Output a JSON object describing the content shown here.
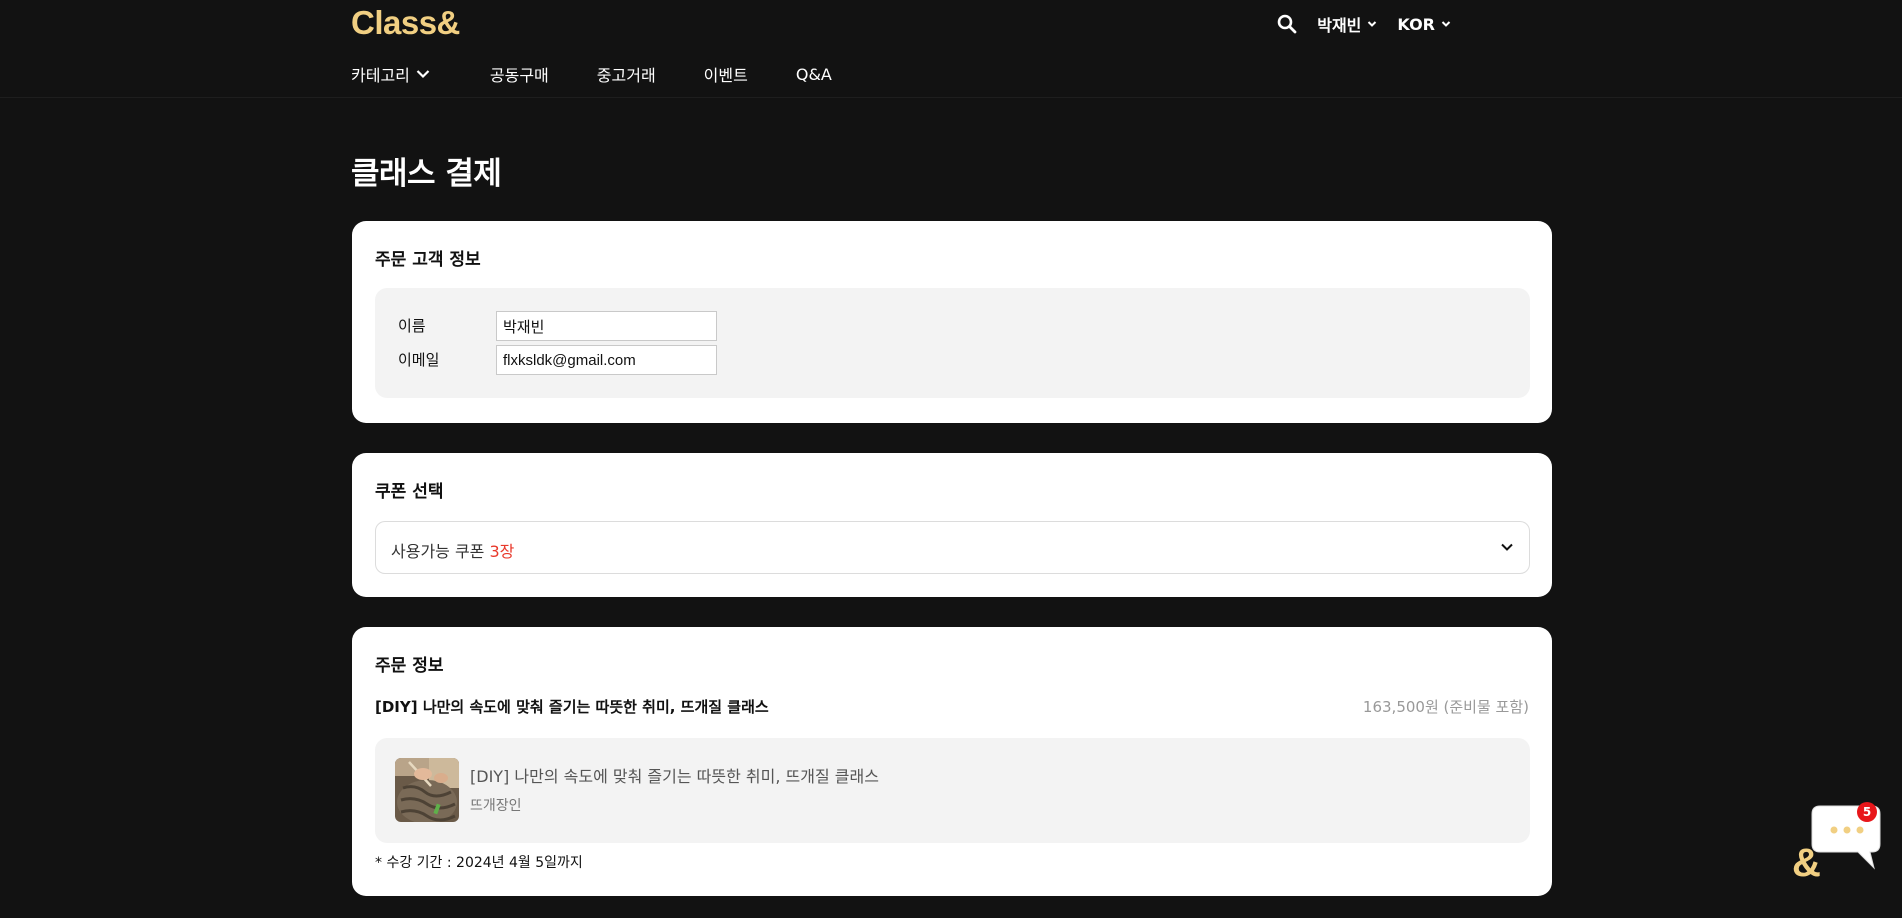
{
  "header": {
    "logo": "Class&",
    "user_menu": "박재빈",
    "language": "KOR"
  },
  "nav": {
    "items": [
      {
        "label": "카테고리"
      },
      {
        "label": "공동구매"
      },
      {
        "label": "중고거래"
      },
      {
        "label": "이벤트"
      },
      {
        "label": "Q&A"
      }
    ]
  },
  "page": {
    "title": "클래스 결제"
  },
  "customer": {
    "title": "주문 고객 정보",
    "name_label": "이름",
    "name_value": "박재빈",
    "email_label": "이메일",
    "email_value": "flxksldk@gmail.com"
  },
  "coupon": {
    "title": "쿠폰 선택",
    "available_label": "사용가능 쿠폰",
    "available_count": "3장"
  },
  "order": {
    "title": "주문 정보",
    "class_name": "[DIY] 나만의 속도에 맞춰 즐기는 따뜻한 취미, 뜨개질 클래스",
    "price": "163,500원 (준비물 포함)",
    "product_title": "[DIY] 나만의 속도에 맞춰 즐기는 따뜻한 취미, 뜨개질 클래스",
    "seller": "뜨개장인",
    "period": "* 수강 기간 : 2024년 4월 5일까지"
  },
  "chat": {
    "badge_count": "5"
  },
  "colors": {
    "background": "#121212",
    "logo": "#f1cf82",
    "card": "#ffffff",
    "box": "#f3f3f3",
    "accent_red": "#e8392b"
  }
}
